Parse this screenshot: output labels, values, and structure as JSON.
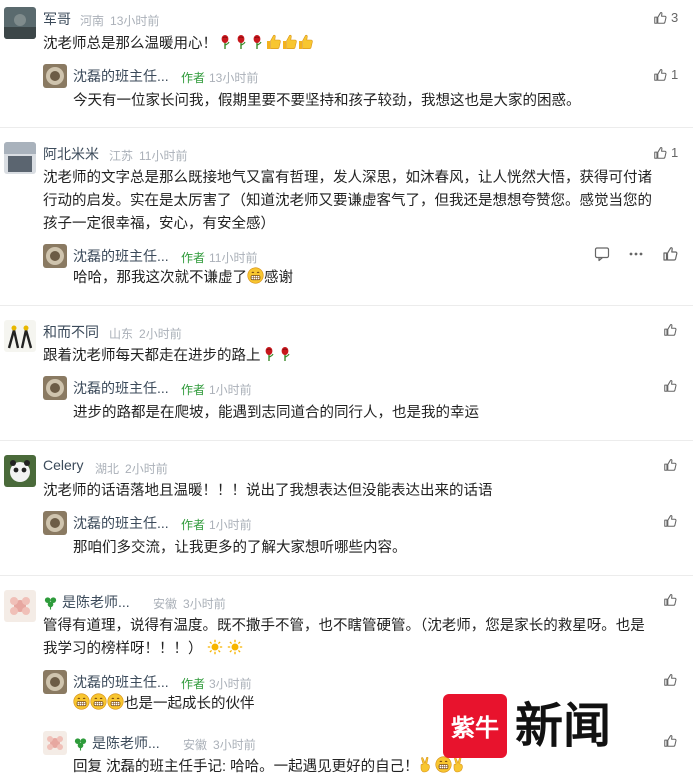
{
  "comments": [
    {
      "name": "军哥",
      "location": "河南",
      "time": "13小时前",
      "likes": "3",
      "text": "沈老师总是那么温暖用心！",
      "reply": {
        "name": "沈磊的班主任...",
        "tag": "作者",
        "time": "13小时前",
        "likes": "1",
        "text": "今天有一位家长问我，假期里要不要坚持和孩子较劲，我想这也是大家的困惑。"
      }
    },
    {
      "name": "阿北米米",
      "location": "江苏",
      "time": "11小时前",
      "likes": "1",
      "text_lines": [
        "沈老师的文字总是那么既接地气又富有哲理，发人深思，如沐春风，让人恍然大悟，获得可付诸",
        "行动的启发。实在是太厉害了（知道沈老师又要谦虚客气了，但我还是想想夸赞您。感觉当您的",
        "孩子一定很幸福，安心，有安全感）"
      ],
      "reply": {
        "name": "沈磊的班主任...",
        "tag": "作者",
        "time": "11小时前",
        "text": "哈哈，那我这次就不谦虚了",
        "text_tail": "感谢"
      }
    },
    {
      "name": "和而不同",
      "location": "山东",
      "time": "2小时前",
      "text": "跟着沈老师每天都走在进步的路上",
      "reply": {
        "name": "沈磊的班主任...",
        "tag": "作者",
        "time": "1小时前",
        "text": "进步的路都是在爬坡，能遇到志同道合的同行人，也是我的幸运"
      }
    },
    {
      "name": "Celery",
      "location": "湖北",
      "time": "2小时前",
      "text": "沈老师的话语落地且温暖！！！说出了我想表达但没能表达出来的话语",
      "reply": {
        "name": "沈磊的班主任...",
        "tag": "作者",
        "time": "1小时前",
        "text": "那咱们多交流，让我更多的了解大家想听哪些内容。"
      }
    },
    {
      "name": "是陈老师...",
      "location": "安徽",
      "time": "3小时前",
      "text_lines": [
        "管得有道理，说得有温度。既不撒手不管，也不瞎管硬管。（沈老师，您是家长的救星呀。也是",
        "我学习的榜样呀！！！）"
      ],
      "reply": {
        "name": "沈磊的班主任...",
        "tag": "作者",
        "time": "3小时前",
        "text": "也是一起成长的伙伴"
      },
      "reply2": {
        "name": "是陈老师...",
        "location": "安徽",
        "time": "3小时前",
        "text": "回复 沈磊的班主任手记: 哈哈。一起遇见更好的自己！"
      }
    }
  ],
  "watermark": {
    "brand": "紫牛",
    "label": "新闻"
  },
  "colors": {
    "author_tag": "#2f9a3a",
    "name": "#3b4a5a",
    "meta": "#aab0b8",
    "brand_red": "#e8132d"
  },
  "icons": [
    "thumb-up-icon",
    "comment-icon",
    "more-icon",
    "rose-emoji",
    "thumbs-up-emoji",
    "grin-emoji",
    "sun-emoji",
    "clover-icon",
    "victory-emoji"
  ]
}
